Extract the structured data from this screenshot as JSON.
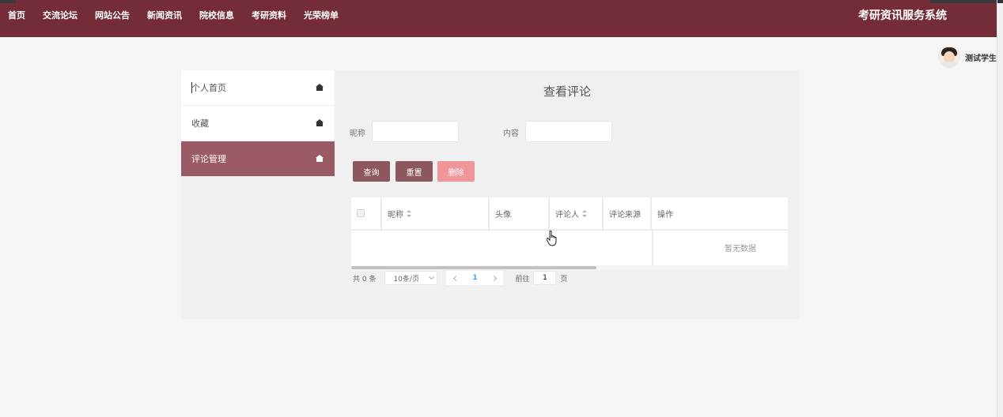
{
  "nav": {
    "items": [
      "首页",
      "交流论坛",
      "网站公告",
      "新闻资讯",
      "院校信息",
      "考研资料",
      "光荣榜单"
    ],
    "site_title": "考研资讯服务系统"
  },
  "user": {
    "name": "测试学生",
    "avatar_icon": "avatar-icon"
  },
  "sidebar": {
    "items": [
      {
        "label": "个人首页",
        "icon": "home-icon"
      },
      {
        "label": "收藏",
        "icon": "home-icon"
      },
      {
        "label": "评论管理",
        "icon": "home-icon",
        "active": true
      }
    ]
  },
  "main": {
    "title": "查看评论",
    "filters": {
      "nickname_label": "昵称",
      "nickname_value": "",
      "content_label": "内容",
      "content_value": ""
    },
    "buttons": {
      "query": "查询",
      "reset": "重置",
      "delete": "删除"
    },
    "table": {
      "columns": [
        "昵称",
        "头像",
        "评论人",
        "评论来源",
        "操作"
      ],
      "empty_text": "暂无数据"
    },
    "pagination": {
      "total": "共 0 条",
      "page_size": "10条/页",
      "current_page": "1",
      "goto_label": "前往",
      "goto_value": "1",
      "goto_suffix": "页"
    }
  },
  "colors": {
    "nav_bg": "#742d38",
    "active_sidebar": "#9b5b66",
    "primary_button": "#8d5760",
    "delete_button": "#f0959a"
  }
}
